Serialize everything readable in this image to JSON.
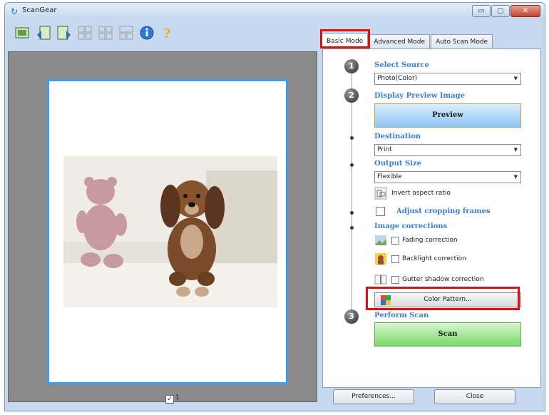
{
  "window": {
    "title": "ScanGear"
  },
  "titlebar_buttons": {
    "minimize": "▭",
    "maximize": "▢",
    "close": "✕"
  },
  "tabs": [
    {
      "label": "Basic Mode",
      "active": true
    },
    {
      "label": "Advanced Mode",
      "active": false
    },
    {
      "label": "Auto Scan Mode",
      "active": false
    }
  ],
  "steps": {
    "one": "1",
    "two": "2",
    "three": "3"
  },
  "select_source": {
    "label": "Select Source",
    "value": "Photo(Color)"
  },
  "display_preview": {
    "label": "Display Preview Image",
    "button": "Preview"
  },
  "destination": {
    "label": "Destination",
    "value": "Print"
  },
  "output_size": {
    "label": "Output Size",
    "value": "Flexible"
  },
  "invert_aspect": {
    "label": "Invert aspect ratio"
  },
  "adjust_cropping": {
    "label": "Adjust cropping frames",
    "checked": false
  },
  "image_corrections": {
    "label": "Image corrections",
    "fading": "Fading correction",
    "backlight": "Backlight correction",
    "gutter": "Gutter shadow correction"
  },
  "color_pattern": {
    "label": "Color Pattern..."
  },
  "perform_scan": {
    "label": "Perform Scan",
    "button": "Scan"
  },
  "preview": {
    "page_check": "✓",
    "page_number": "1"
  },
  "bottom": {
    "preferences": "Preferences...",
    "close": "Close"
  },
  "colors": {
    "accent": "#3b80d0",
    "highlight": "#e01010",
    "scan_button": "#7ad86a",
    "preview_button": "#8cc4f2"
  }
}
